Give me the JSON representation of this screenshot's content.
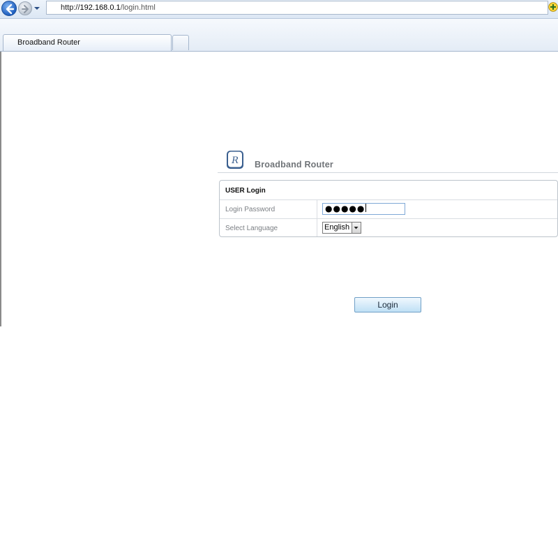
{
  "browser": {
    "address": {
      "scheme": "http://",
      "host": "192.168.0.1",
      "path": "/login.html"
    },
    "tab": {
      "title": "Broadband Router"
    }
  },
  "page": {
    "brand_title": "Broadband Router",
    "logo_letter": "R",
    "login_box": {
      "title": "USER Login",
      "password_label": "Login Password",
      "password_mask": "●●●●●",
      "language_label": "Select Language",
      "language_selected": "English"
    },
    "login_button": "Login"
  },
  "icons": {
    "back": "back-arrow-icon",
    "forward": "forward-arrow-icon",
    "history": "chevron-down-icon",
    "compat": "compatibility-view-icon",
    "home": "home-icon",
    "logo": "router-logo-icon"
  },
  "colors": {
    "accent_blue": "#1f5fbf",
    "logo_blue": "#3a5f8f",
    "brand_text": "#707478",
    "button_fill": "#bfe0f5"
  }
}
